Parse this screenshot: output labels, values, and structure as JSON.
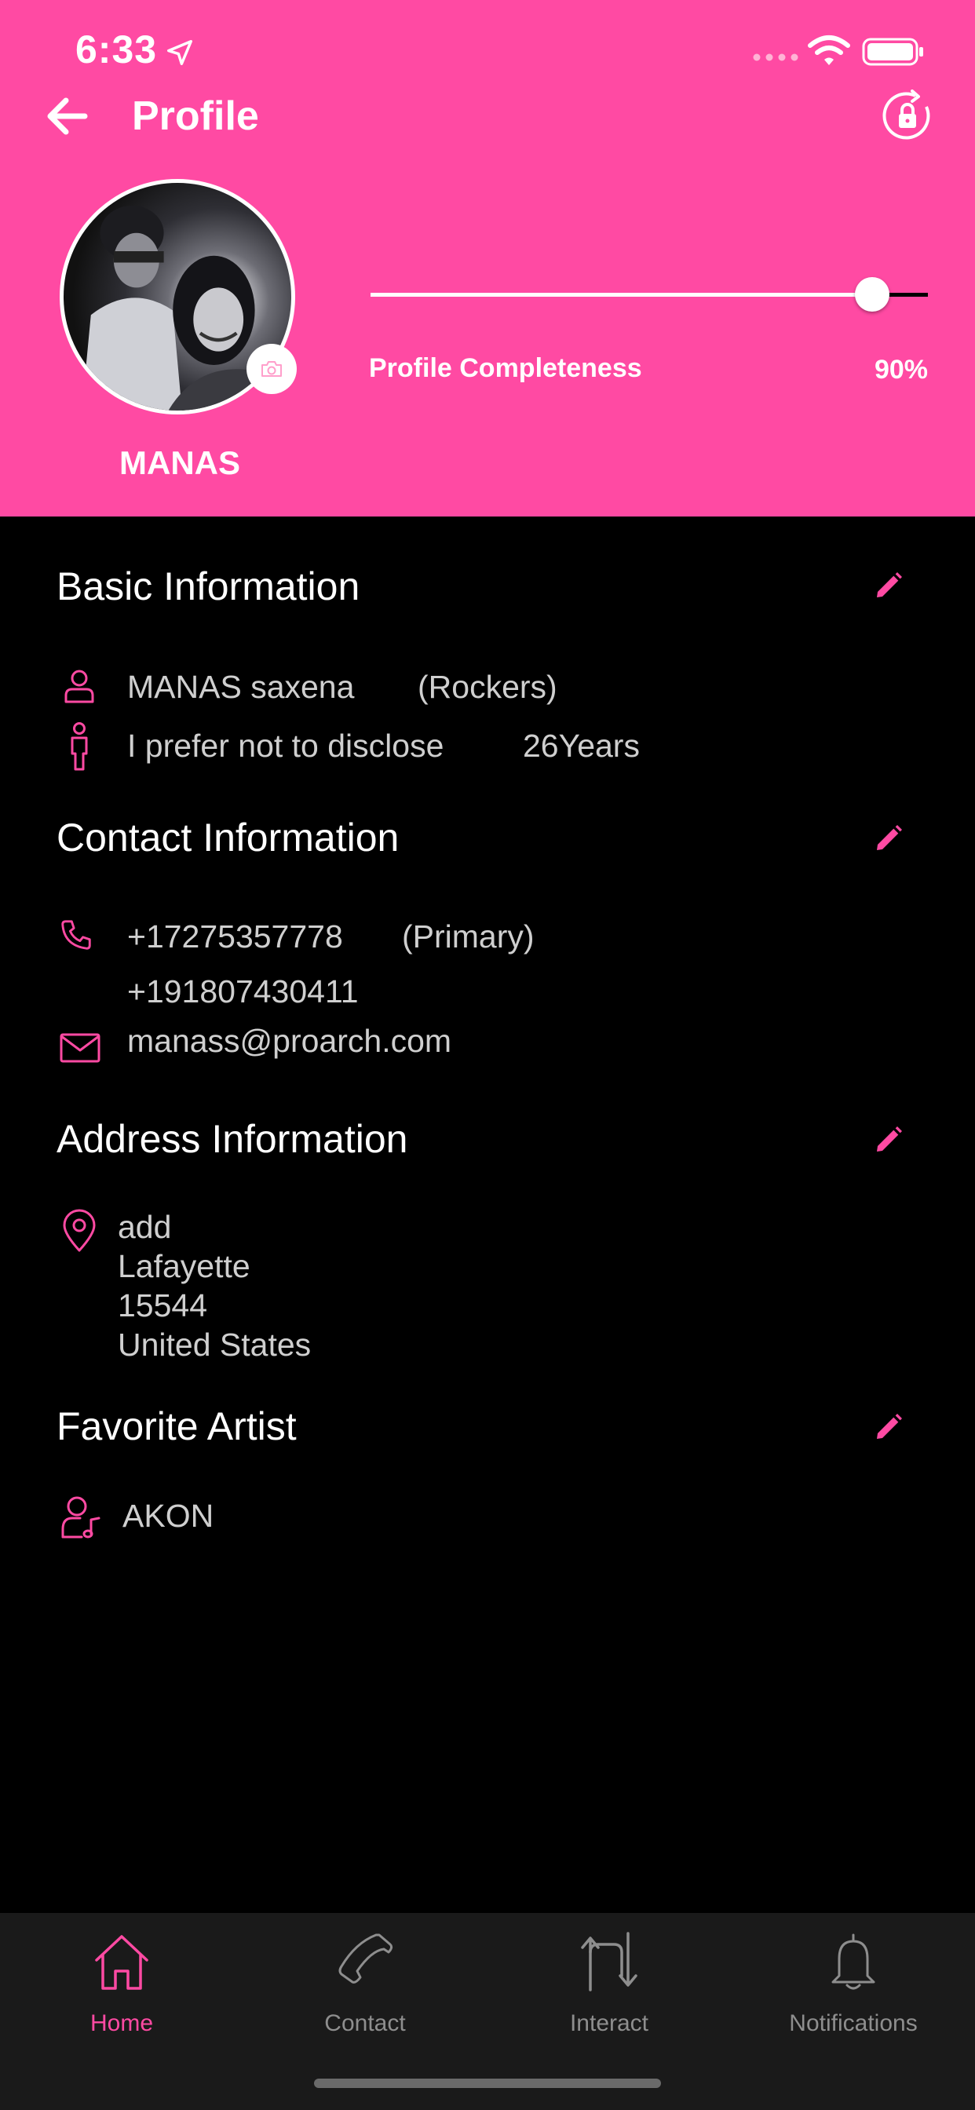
{
  "status_bar": {
    "time": "6:33"
  },
  "header": {
    "title": "Profile",
    "username": "MANAS"
  },
  "completeness": {
    "label": "Profile Completeness",
    "value_text": "90%",
    "fraction": 0.9
  },
  "basic": {
    "title": "Basic Information",
    "name": "MANAS saxena",
    "group": "(Rockers)",
    "gender": "I prefer not to disclose",
    "age": "26Years"
  },
  "contact": {
    "title": "Contact Information",
    "phone_primary": "+17275357778",
    "primary_tag": "(Primary)",
    "phone_secondary": "+191807430411",
    "email": "manass@proarch.com"
  },
  "address": {
    "title": "Address Information",
    "lines": [
      "add",
      "Lafayette",
      "15544",
      "United States"
    ]
  },
  "artist": {
    "title": "Favorite Artist",
    "name": "AKON"
  },
  "tabs": [
    {
      "label": "Home",
      "icon": "home-icon",
      "active": true
    },
    {
      "label": "Contact",
      "icon": "phone-icon",
      "active": false
    },
    {
      "label": "Interact",
      "icon": "interact-arrows-icon",
      "active": false
    },
    {
      "label": "Notifications",
      "icon": "bell-icon",
      "active": false
    }
  ],
  "colors": {
    "accent": "#ff4aa3",
    "background": "#000000",
    "tabbar": "#1a1a1a"
  }
}
